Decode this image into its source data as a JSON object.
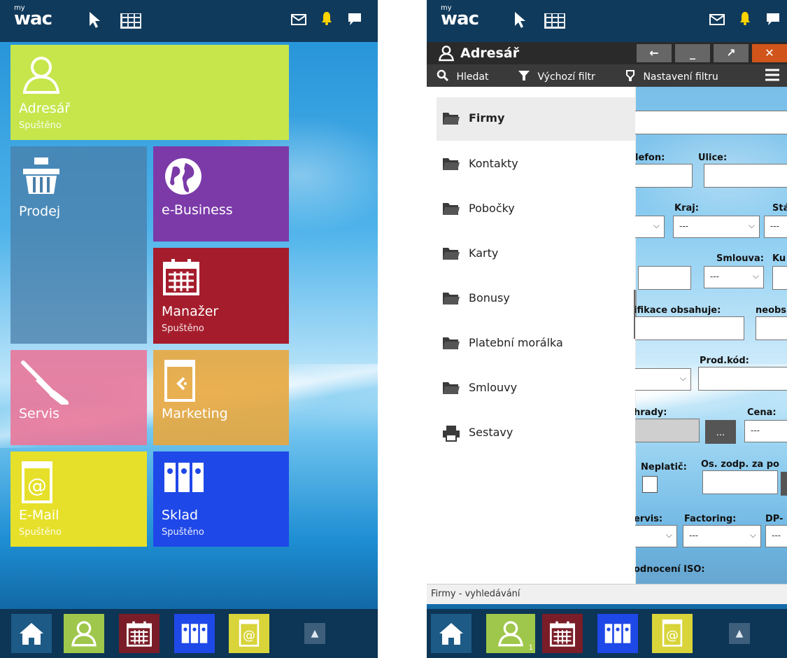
{
  "app": {
    "logo_my": "my",
    "logo_text": "wac"
  },
  "left_screen": {
    "tiles": [
      {
        "key": "adresar",
        "label": "Adresář",
        "sub": "Spuštěno",
        "color": "#c6e64b",
        "icon": "users-icon"
      },
      {
        "key": "prodej",
        "label": "Prodej",
        "sub": "",
        "color": "#4a7ea8",
        "icon": "basket-icon"
      },
      {
        "key": "ebusiness",
        "label": "e-Business",
        "sub": "",
        "color": "#7b3aa8",
        "icon": "globe-icon"
      },
      {
        "key": "manazer",
        "label": "Manažer",
        "sub": "Spuštěno",
        "color": "#a51d2c",
        "icon": "calendar-icon"
      },
      {
        "key": "servis",
        "label": "Servis",
        "sub": "",
        "color": "#e9779a",
        "icon": "screwdriver-icon"
      },
      {
        "key": "marketing",
        "label": "Marketing",
        "sub": "",
        "color": "#e8a73e",
        "icon": "book-icon"
      },
      {
        "key": "email",
        "label": "E-Mail",
        "sub": "Spuštěno",
        "color": "#e6e02a",
        "icon": "email-book-icon"
      },
      {
        "key": "sklad",
        "label": "Sklad",
        "sub": "Spuštěno",
        "color": "#1f48e8",
        "icon": "binders-icon"
      }
    ]
  },
  "bottombar": {
    "buttons": [
      {
        "name": "home",
        "color": "#1d5a86",
        "icon": "home-icon"
      },
      {
        "name": "adresar",
        "color": "#9fc74b",
        "icon": "users-icon"
      },
      {
        "name": "manazer",
        "color": "#7a1d28",
        "icon": "calendar-icon"
      },
      {
        "name": "sklad",
        "color": "#1f48e8",
        "icon": "binders-icon"
      },
      {
        "name": "email",
        "color": "#d8d43a",
        "icon": "email-book-icon"
      }
    ],
    "badge": "1"
  },
  "right_screen": {
    "window_title": "Adresář",
    "toolbar": {
      "search": "Hledat",
      "default_filter": "Výchozí filtr",
      "filter_settings": "Nastavení filtru"
    },
    "nav": [
      {
        "label": "Firmy",
        "icon": "folder-icon",
        "selected": true
      },
      {
        "label": "Kontakty",
        "icon": "folder-icon"
      },
      {
        "label": "Pobočky",
        "icon": "folder-icon"
      },
      {
        "label": "Karty",
        "icon": "folder-icon"
      },
      {
        "label": "Bonusy",
        "icon": "folder-icon"
      },
      {
        "label": "Platební morálka",
        "icon": "folder-icon"
      },
      {
        "label": "Smlouvy",
        "icon": "folder-icon"
      },
      {
        "label": "Sestavy",
        "icon": "printer-icon"
      }
    ],
    "form": {
      "telefon": "lefon:",
      "ulice": "Ulice:",
      "kraj": "Kraj:",
      "stat": "Stát",
      "kraj_value": "---",
      "stat_value": "---",
      "smlouva": "Smlouva:",
      "ku": "Ku",
      "smlouva_value": "---",
      "klasifikace": "ifikace obsahuje:",
      "neobsahuje": "neobs",
      "prodkod": "Prod.kód:",
      "uhrady": "hrady:",
      "cena": "Cena:",
      "cena_value": "---",
      "ellipsis": "...",
      "neplatic": "Neplatič:",
      "oszodp": "Os. zodp. za po",
      "servis": "ervis:",
      "factoring": "Factoring:",
      "dp": "DP-",
      "servis_value": "",
      "factoring_value": "---",
      "dp_value": "---",
      "hodnoceni": "odnocení ISO:"
    },
    "status": "Firmy - vyhledávání"
  }
}
